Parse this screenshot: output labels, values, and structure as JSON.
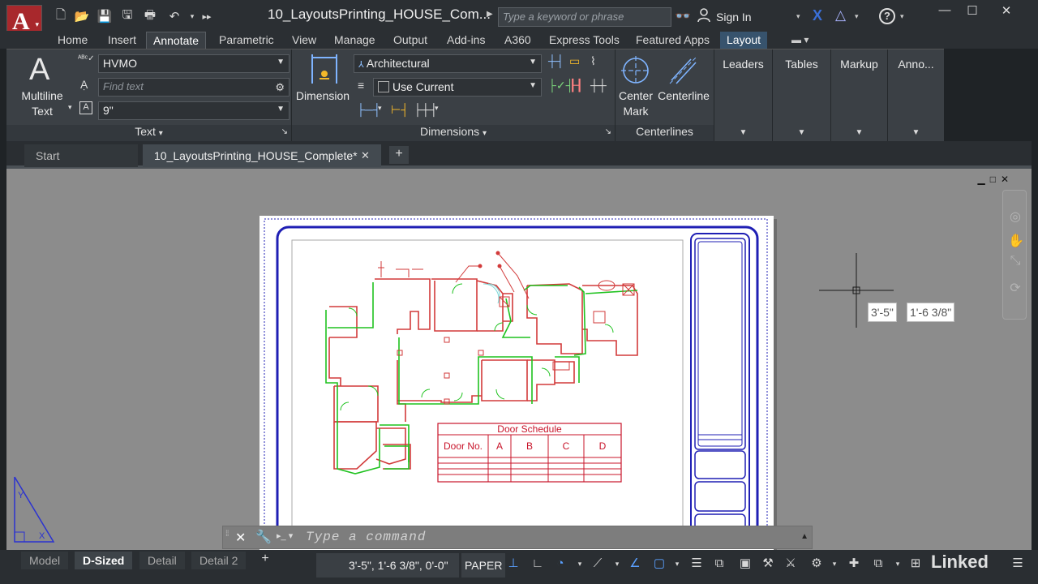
{
  "window": {
    "document_title": "10_LayoutsPrinting_HOUSE_Com...",
    "search_placeholder": "Type a keyword or phrase",
    "sign_in": "Sign In",
    "app_letter": "A"
  },
  "ribbon_tabs": [
    "Home",
    "Insert",
    "Annotate",
    "Parametric",
    "View",
    "Manage",
    "Output",
    "Add-ins",
    "A360",
    "Express Tools",
    "Featured Apps",
    "Layout"
  ],
  "active_tab": "Annotate",
  "text_panel": {
    "multiline_label_1": "Multiline",
    "multiline_label_2": "Text",
    "text_style": "HVMO",
    "find_placeholder": "Find text",
    "text_height": "9\"",
    "title": "Text"
  },
  "dimensions_panel": {
    "dimension_label": "Dimension",
    "dim_style": "Architectural",
    "layer": "Use Current",
    "title": "Dimensions"
  },
  "centerlines_panel": {
    "center_mark_1": "Center",
    "center_mark_2": "Mark",
    "centerline": "Centerline",
    "title": "Centerlines"
  },
  "side_panels": [
    "Leaders",
    "Tables",
    "Markup",
    "Anno..."
  ],
  "file_tabs": {
    "start": "Start",
    "active": "10_LayoutsPrinting_HOUSE_Complete*"
  },
  "drawing": {
    "door_schedule_title": "Door Schedule",
    "door_schedule_headers": [
      "Door No.",
      "A",
      "B",
      "C",
      "D"
    ],
    "cursor_x": "3'-5\"",
    "cursor_y": "1'-6 3/8\""
  },
  "command_line": {
    "placeholder": "Type a command"
  },
  "layout_tabs": [
    "Model",
    "D-Sized",
    "Detail",
    "Detail 2"
  ],
  "active_layout": "D-Sized",
  "status": {
    "coordinates": "3'-5\", 1'-6 3/8\", 0'-0\"",
    "space": "PAPER"
  },
  "colors": {
    "app_red": "#a8282c",
    "accent_blue": "#37536d",
    "sheet_border": "#1f1fb4",
    "wall_red": "#d23a3a",
    "wall_green": "#1fc21f",
    "schedule_red": "#c8142a"
  },
  "watermark": "Linked"
}
